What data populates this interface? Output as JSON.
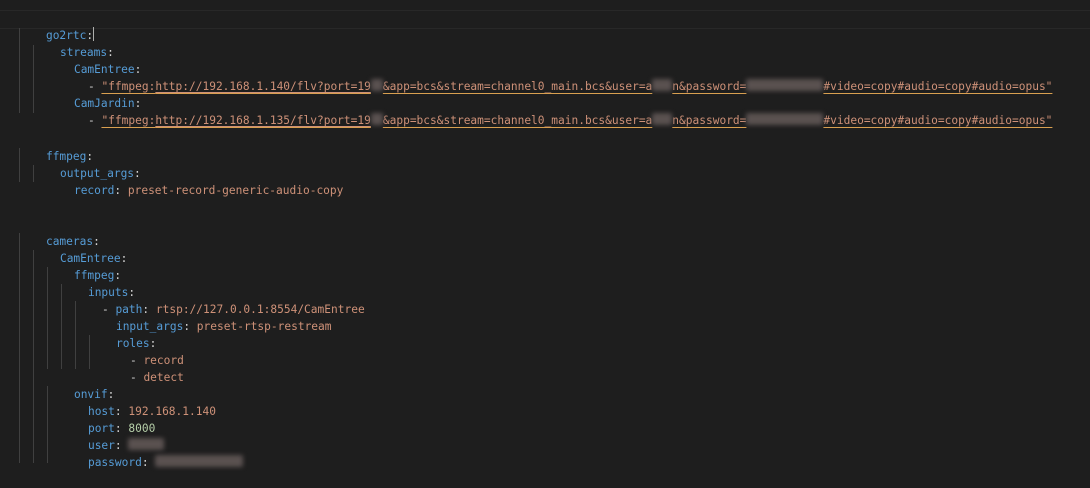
{
  "editor": {
    "lines": {
      "l1": {
        "key": "go2rtc",
        "colon": ":"
      },
      "l2": {
        "key": "streams",
        "colon": ":"
      },
      "l3": {
        "key": "CamEntree",
        "colon": ":"
      },
      "l4": {
        "dash": "- ",
        "pre": "\"ffmpeg:",
        "url": "http://192.168.1.140/flv?port=19",
        "mid": "&app=bcs&stream=channel0_main.bcs&user=a",
        "mid2": "n",
        "mid3": "&password=",
        "tail": "#video=copy#audio=copy#audio=opus\""
      },
      "l5": {
        "key": "CamJardin",
        "colon": ":"
      },
      "l6": {
        "dash": "- ",
        "pre": "\"ffmpeg:",
        "url": "http://192.168.1.135/flv?port=19",
        "mid": "&app=bcs&stream=channel0_main.bcs&user=a",
        "mid2": "n",
        "mid3": "&password=",
        "tail": "#video=copy#audio=copy#audio=opus\""
      },
      "l8": {
        "key": "ffmpeg",
        "colon": ":"
      },
      "l9": {
        "key": "output_args",
        "colon": ":"
      },
      "l10": {
        "key": "record",
        "colon": ": ",
        "value": "preset-record-generic-audio-copy"
      },
      "l13": {
        "key": "cameras",
        "colon": ":"
      },
      "l14": {
        "key": "CamEntree",
        "colon": ":"
      },
      "l15": {
        "key": "ffmpeg",
        "colon": ":"
      },
      "l16": {
        "key": "inputs",
        "colon": ":"
      },
      "l17": {
        "dash": "- ",
        "key": "path",
        "colon": ": ",
        "value": "rtsp://127.0.0.1:8554/CamEntree"
      },
      "l18": {
        "key": "input_args",
        "colon": ": ",
        "value": "preset-rtsp-restream"
      },
      "l19": {
        "key": "roles",
        "colon": ":"
      },
      "l20": {
        "dash": "- ",
        "value": "record"
      },
      "l21": {
        "dash": "- ",
        "value": "detect"
      },
      "l22": {
        "key": "onvif",
        "colon": ":"
      },
      "l23": {
        "key": "host",
        "colon": ": ",
        "value": "192.168.1.140"
      },
      "l24": {
        "key": "port",
        "colon": ": ",
        "value": "8000"
      },
      "l25": {
        "key": "user",
        "colon": ": "
      },
      "l26": {
        "key": "password",
        "colon": ": "
      }
    }
  }
}
